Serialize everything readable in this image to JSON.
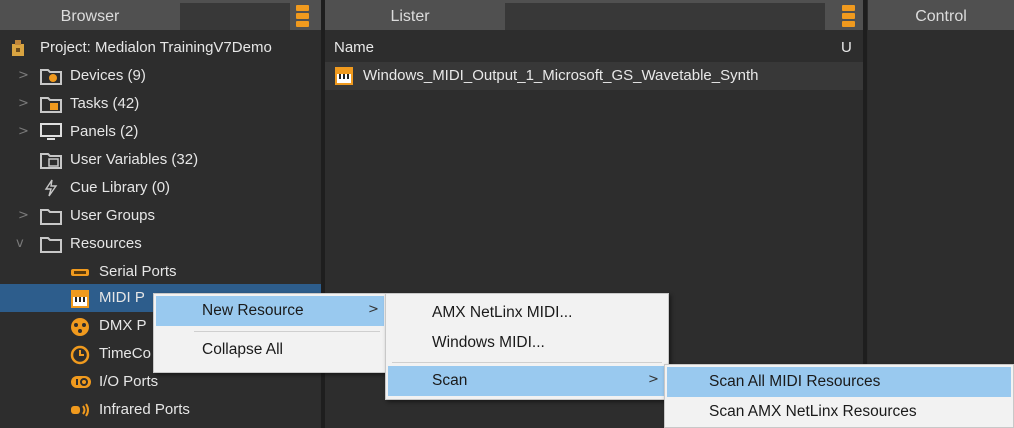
{
  "browser": {
    "title": "Browser",
    "project": "Project: Medialon TrainingV7Demo",
    "items": [
      {
        "label": "Devices (9)",
        "icon": "devices-folder-icon",
        "arrow": ">"
      },
      {
        "label": "Tasks (42)",
        "icon": "tasks-folder-icon",
        "arrow": ">"
      },
      {
        "label": "Panels (2)",
        "icon": "monitor-icon",
        "arrow": ">"
      },
      {
        "label": "User Variables (32)",
        "icon": "variables-folder-icon",
        "arrow": ""
      },
      {
        "label": "Cue Library (0)",
        "icon": "lightning-icon",
        "arrow": ""
      },
      {
        "label": "User Groups",
        "icon": "folder-icon",
        "arrow": ">"
      },
      {
        "label": "Resources",
        "icon": "folder-icon",
        "arrow": "v"
      }
    ],
    "resources": [
      {
        "label": "Serial Ports",
        "icon": "serial-port-icon"
      },
      {
        "label": "MIDI P",
        "icon": "midi-icon"
      },
      {
        "label": "DMX P",
        "icon": "dmx-icon"
      },
      {
        "label": "TimeCo",
        "icon": "timecode-icon"
      },
      {
        "label": "I/O Ports",
        "icon": "io-icon"
      },
      {
        "label": "Infrared Ports",
        "icon": "infrared-icon"
      }
    ]
  },
  "lister": {
    "title": "Lister",
    "col_name": "Name",
    "col_u": "U",
    "row_label": "Windows_MIDI_Output_1_Microsoft_GS_Wavetable_Synth"
  },
  "control": {
    "title": "Control"
  },
  "context_menu": {
    "new_resource": "New Resource",
    "collapse_all": "Collapse All",
    "submenu_arrow": ">"
  },
  "new_resource_menu": {
    "amx": "AMX NetLinx MIDI...",
    "windows": "Windows MIDI...",
    "scan": "Scan"
  },
  "scan_menu": {
    "scan_all": "Scan All MIDI Resources",
    "scan_amx": "Scan AMX NetLinx Resources"
  },
  "colors": {
    "accent": "#f09a1e",
    "selection": "#2d5d8c",
    "menu_highlight": "#99c9ef"
  }
}
